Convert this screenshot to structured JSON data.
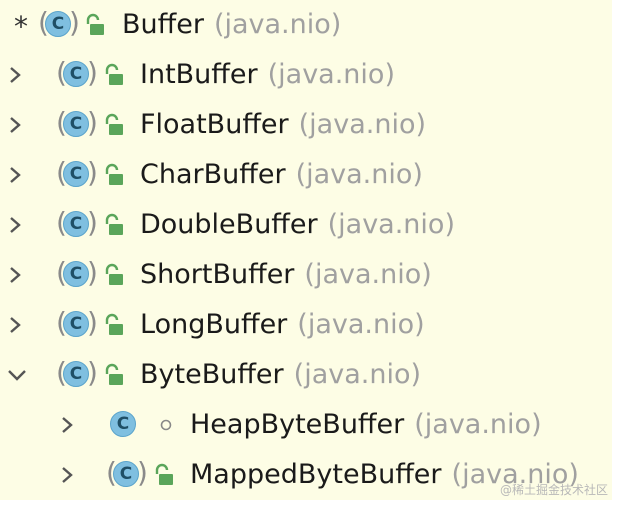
{
  "tree": {
    "root": {
      "name": "Buffer",
      "pkg": "(java.nio)",
      "marker": "*"
    },
    "children": [
      {
        "name": "IntBuffer",
        "pkg": "(java.nio)"
      },
      {
        "name": "FloatBuffer",
        "pkg": "(java.nio)"
      },
      {
        "name": "CharBuffer",
        "pkg": "(java.nio)"
      },
      {
        "name": "DoubleBuffer",
        "pkg": "(java.nio)"
      },
      {
        "name": "ShortBuffer",
        "pkg": "(java.nio)"
      },
      {
        "name": "LongBuffer",
        "pkg": "(java.nio)"
      },
      {
        "name": "ByteBuffer",
        "pkg": "(java.nio)"
      }
    ],
    "grandchildren": [
      {
        "name": "HeapByteBuffer",
        "pkg": "(java.nio)"
      },
      {
        "name": "MappedByteBuffer",
        "pkg": "(java.nio)"
      }
    ]
  },
  "class_icon_letter": "C",
  "icons": {
    "collapsed": "chevron-right-icon",
    "expanded": "chevron-down-icon",
    "abstract_class": "abstract-class-icon",
    "class": "class-icon",
    "public": "public-lock-icon",
    "package_private": "package-private-dot-icon"
  },
  "colors": {
    "background": "#fdfde5",
    "class_icon": "#7fbfe0",
    "public_icon": "#5aa55a",
    "package_text": "#a0a0a0"
  },
  "watermark": "@稀土掘金技术社区"
}
